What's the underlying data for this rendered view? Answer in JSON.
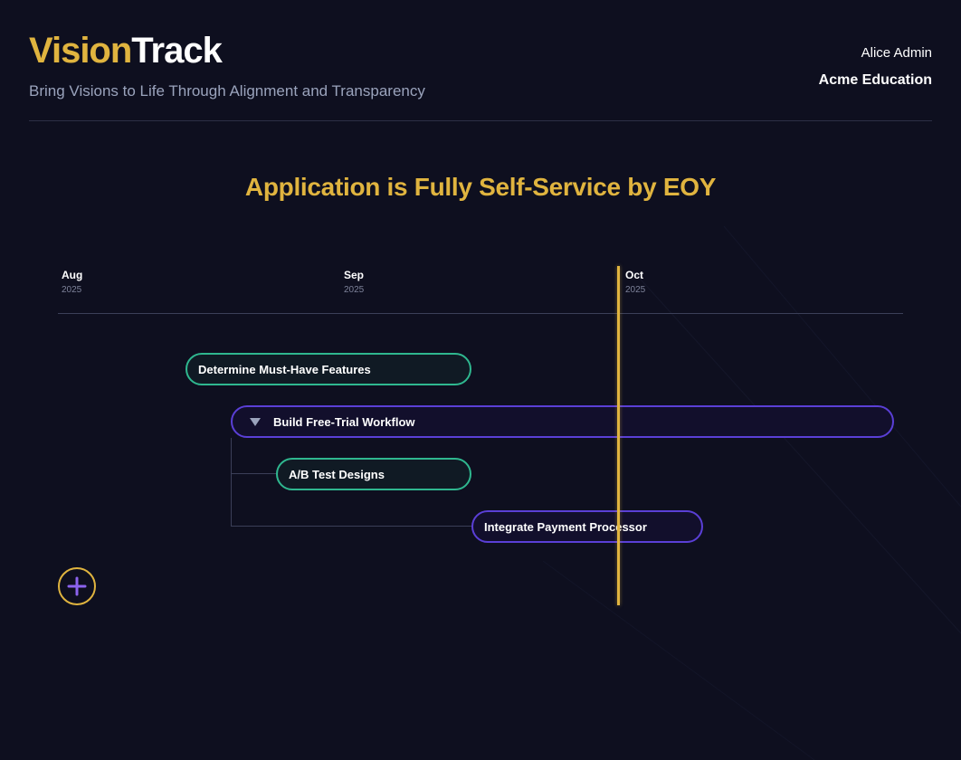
{
  "app": {
    "logo_part_a": "Vision",
    "logo_part_b": "Track",
    "tagline": "Bring Visions to Life Through Alignment and Transparency",
    "user_name": "Alice Admin",
    "org_name": "Acme Education"
  },
  "vision": {
    "title": "Application is Fully Self-Service by EOY"
  },
  "timeline": {
    "months": [
      {
        "name": "Aug",
        "year": "2025"
      },
      {
        "name": "Sep",
        "year": "2025"
      },
      {
        "name": "Oct",
        "year": "2025"
      }
    ],
    "items": [
      {
        "label": "Determine Must-Have Features",
        "status_color": "#2fb78f"
      },
      {
        "label": "Build Free-Trial Workflow",
        "status_color": "#5a3fd6",
        "expanded": true
      },
      {
        "label": "A/B Test Designs",
        "status_color": "#2fb78f"
      },
      {
        "label": "Integrate Payment Processor",
        "status_color": "#5a3fd6"
      }
    ]
  },
  "colors": {
    "accent": "#e0b43f",
    "background": "#0e0f1f",
    "green": "#2fb78f",
    "purple": "#5a3fd6"
  },
  "icons": {
    "add": "plus-icon",
    "collapse": "caret-down-icon"
  }
}
